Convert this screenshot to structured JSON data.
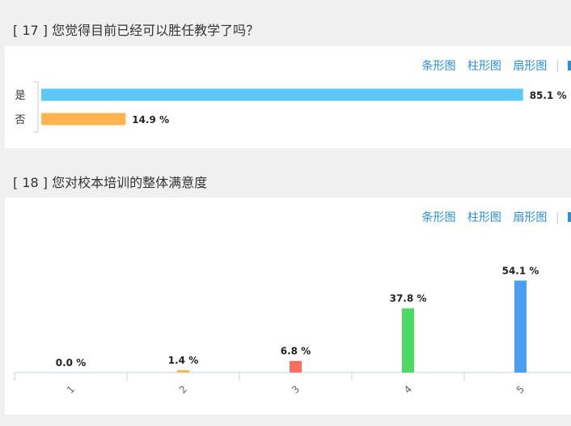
{
  "questions": [
    {
      "title": "[ 17 ] 您觉得目前已经可以胜任教学了吗？",
      "tabs": [
        "条形图",
        "柱形图",
        "扇形图"
      ],
      "chart_data": {
        "type": "bar",
        "orientation": "horizontal",
        "categories": [
          "是",
          "否"
        ],
        "values": [
          85.1,
          14.9
        ],
        "value_labels": [
          "85.1 %",
          "14.9 %"
        ],
        "colors": [
          "#5bc8fa",
          "#ffb44f"
        ]
      }
    },
    {
      "title": "[ 18 ] 您对校本培训的整体满意度",
      "tabs": [
        "条形图",
        "柱形图",
        "扇形图"
      ],
      "chart_data": {
        "type": "bar",
        "orientation": "vertical",
        "categories": [
          "1",
          "2",
          "3",
          "4",
          "5"
        ],
        "values": [
          0.0,
          1.4,
          6.8,
          37.8,
          54.1
        ],
        "value_labels": [
          "0.0 %",
          "1.4 %",
          "6.8 %",
          "37.8 %",
          "54.1 %"
        ],
        "colors": [
          "#5bc8fa",
          "#ffb44f",
          "#fa6e5f",
          "#4cd964",
          "#4a9ff5"
        ]
      }
    }
  ]
}
